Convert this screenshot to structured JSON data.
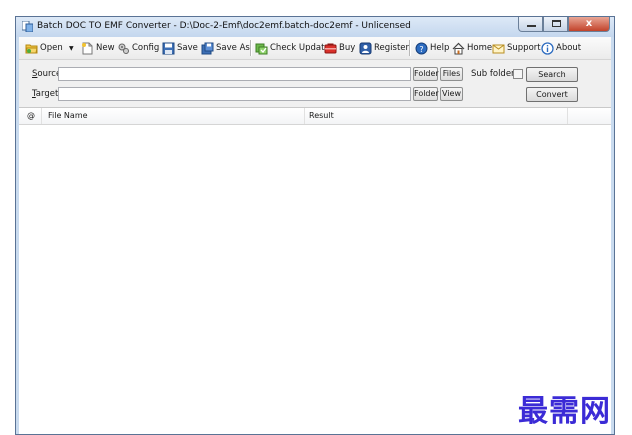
{
  "window": {
    "title": "Batch DOC TO EMF Converter - D:\\Doc-2-Emf\\doc2emf.batch-doc2emf - Unlicensed",
    "close_glyph": "x"
  },
  "toolbar": {
    "items": [
      {
        "label": "Open",
        "icon": "open-folder-icon"
      },
      {
        "label": "New",
        "icon": "new-file-icon"
      },
      {
        "label": "Config",
        "icon": "config-gears-icon"
      },
      {
        "label": "Save",
        "icon": "save-disk-icon"
      },
      {
        "label": "Save As",
        "icon": "save-as-icon"
      },
      {
        "label": "Check Update",
        "icon": "check-update-icon"
      },
      {
        "label": "Buy",
        "icon": "buy-cart-icon"
      },
      {
        "label": "Register",
        "icon": "register-icon"
      },
      {
        "label": "Help",
        "icon": "help-icon"
      },
      {
        "label": "Home",
        "icon": "home-icon"
      },
      {
        "label": "Support",
        "icon": "support-icon"
      },
      {
        "label": "About",
        "icon": "about-icon"
      }
    ],
    "open_dropdown": "▼"
  },
  "form": {
    "source_label_key": "S",
    "source_label_rest": "ource",
    "source_value": "",
    "target_label_key": "T",
    "target_label_rest": "arget",
    "target_value": "",
    "folder_label": "Folder",
    "files_label": "Files",
    "view_label": "View",
    "subfolders_label": "Sub folders",
    "subfolders_checked": false,
    "search_label": "Search",
    "convert_label": "Convert"
  },
  "list": {
    "columns": [
      "@",
      "File Name",
      "Result"
    ],
    "rows": []
  },
  "watermark": "最需网",
  "colors": {
    "titlebar": "#c9dbef",
    "watermark": "#3b2bd6",
    "close_button": "#c2422a"
  }
}
